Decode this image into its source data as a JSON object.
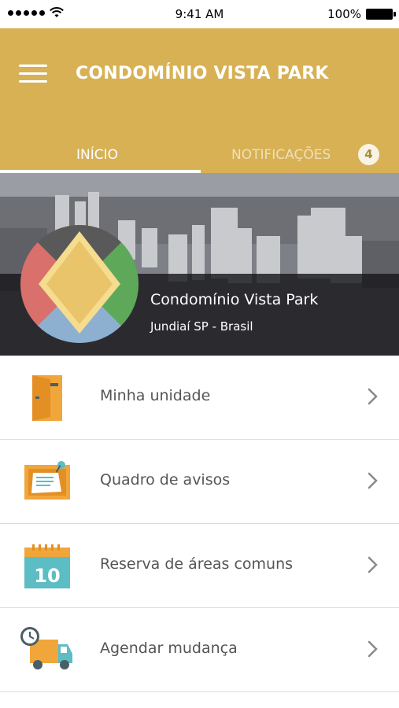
{
  "status_bar": {
    "time": "9:41 AM",
    "battery": "100%"
  },
  "header": {
    "title": "CONDOMÍNIO VISTA PARK",
    "menu_icon": "hamburger-icon",
    "tabs": [
      {
        "label": "INÍCIO",
        "active": true
      },
      {
        "label": "NOTIFICAÇÕES",
        "active": false,
        "badge": "4"
      }
    ]
  },
  "hero": {
    "name": "Condomínio Vista Park",
    "location": "Jundiaí SP - Brasil"
  },
  "menu": [
    {
      "label": "Minha unidade",
      "icon": "door-icon"
    },
    {
      "label": "Quadro de avisos",
      "icon": "notice-board-icon"
    },
    {
      "label": "Reserva de áreas comuns",
      "icon": "calendar-icon"
    },
    {
      "label": "Agendar mudança",
      "icon": "moving-truck-icon"
    }
  ],
  "colors": {
    "header": "#d7b154",
    "icon_orange": "#f0a63a",
    "icon_teal": "#5cbdc4"
  }
}
